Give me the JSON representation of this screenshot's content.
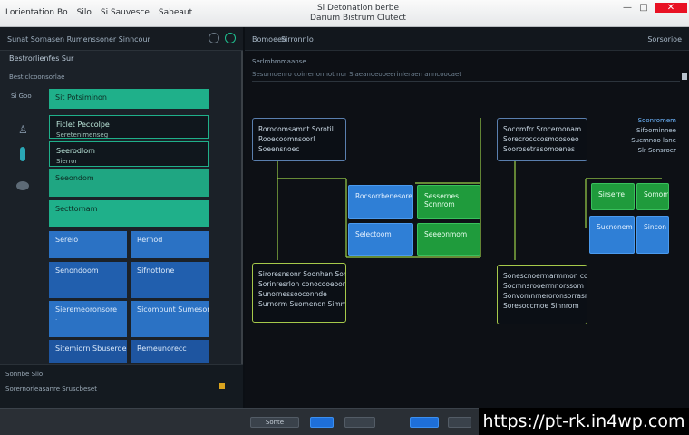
{
  "titlebar": {
    "menu": [
      "Lorientation Bo",
      "Silo",
      "Si Sauvesce",
      "Sabeaut"
    ],
    "title_line1": "Si Detonation berbe",
    "title_line2": "Darium Bistrum Clutect",
    "minimize": "—",
    "maximize": "□",
    "close": "✕"
  },
  "left": {
    "header_title": "Sunat Sornasen Rumenssoner Sinncour",
    "subtitle": "Bestrorlienfes Sur",
    "subtitle2": "Besticlcoonsorlae",
    "side_label": "Si Goo",
    "cards": [
      {
        "l1": "Sit Potsiminon",
        "l2": ""
      },
      {
        "l1": "Ficlet Peccolpe",
        "l2": "Seretenimenseg"
      },
      {
        "l1": "Seerodlom",
        "l2": "Sierror"
      },
      {
        "l1": "Seeondom",
        "l2": ""
      },
      {
        "l1": "Secttornam",
        "l2": ""
      }
    ],
    "grid": [
      {
        "l1": "Sereio",
        "l2": ""
      },
      {
        "l1": "Rernod",
        "l2": ""
      },
      {
        "l1": "Senondoom",
        "l2": ""
      },
      {
        "l1": "Sifnottone",
        "l2": ""
      },
      {
        "l1": "Sieremeoronsore",
        "l2": "·"
      },
      {
        "l1": "Sicompunt Sumesort",
        "l2": ""
      },
      {
        "l1": "Sitemiorn Sbuserdess",
        "l2": ""
      },
      {
        "l1": "Remeunorecc",
        "l2": ""
      }
    ],
    "footer_line1": "Sonnbe Silo",
    "footer_line2": "Sorernorleasanre Sruscbeset"
  },
  "right": {
    "tab1": "Bomoeen",
    "tab2": "Sirronnlo",
    "title": "Sorsorioe",
    "crumb": "Serlmbromaanse",
    "path": "Sesumuenro coirrerlonnot nur Siaeanoeooeerinleraen anncoocaet",
    "nodes": [
      {
        "l1": "Rorocomsamnt Sorotil",
        "l2": "Rooecoomnsoorl",
        "l3": "Soeensnoec"
      },
      {
        "l1": "Socomfrr Sroceroonam",
        "l2": "Sorecrocccosmoosoeo",
        "l3": "Soorosetrasomoenes"
      },
      {
        "l1": "Siroresnsonr Soonhen Sonnnos",
        "l2": "Sorinresrlon conocooeoonuus",
        "l3": "Sunornessooconnde",
        "l4": "Surnorm Suomencn Simm"
      },
      {
        "l1": "Sonescnoermarmmon cooeorr",
        "l2": "Socmnsrooerrnnorssom",
        "l3": "Sonvomnmeroronsorrasnsom",
        "l4": "Soresoccmoe Sinnrom"
      }
    ],
    "blocks": [
      {
        "l1": "Rocsorrbenesoreum"
      },
      {
        "l1": "Sessernes",
        "l2": "Sonnrom"
      },
      {
        "l1": "Selectoom"
      },
      {
        "l1": "Seeeonmom"
      },
      {
        "l1": "Sirserre"
      },
      {
        "l1": "Somom"
      },
      {
        "l1": "Sucnonem"
      },
      {
        "l1": "Sincon"
      }
    ],
    "callout": [
      "Soonromem",
      "Sifoorninnee",
      "Sucmnoo lane",
      "Slr Sonsroer"
    ]
  },
  "status": {
    "btn1": "Sonte",
    "btn2": "",
    "btn3": "",
    "btn4": "",
    "btn5": ""
  },
  "watermark": "https://pt-rk.in4wp.com",
  "colors": {
    "teal": "#1fb08a",
    "blue": "#2f7fd6",
    "green": "#1f9b3c",
    "lime": "#a6c94a"
  }
}
